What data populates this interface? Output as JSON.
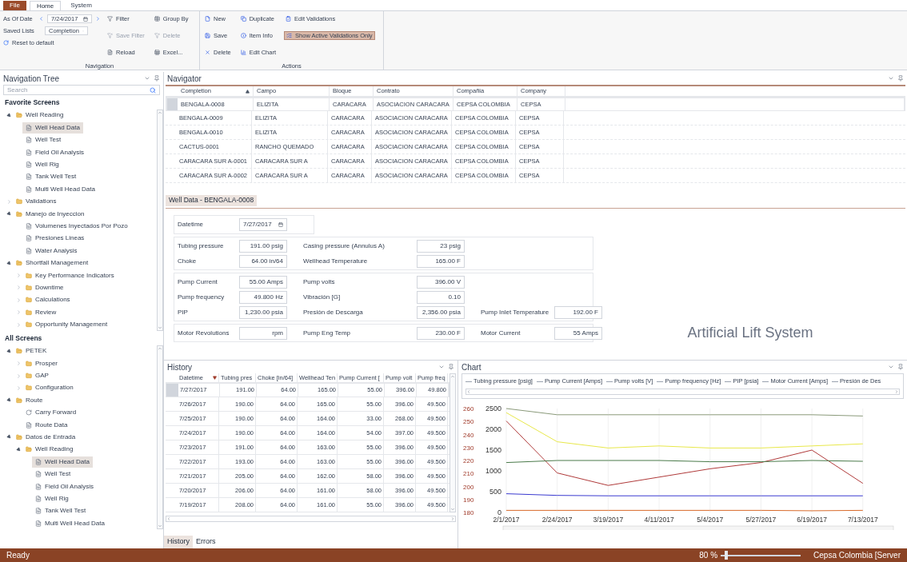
{
  "ribbon": {
    "tabs": [
      {
        "label": "File",
        "selected": false,
        "kind": "file"
      },
      {
        "label": "Home",
        "selected": true,
        "kind": "tab"
      },
      {
        "label": "System",
        "selected": false,
        "kind": "tab"
      }
    ],
    "navigation": {
      "title": "Navigation",
      "as_of_date_label": "As Of Date",
      "date": "7/24/2017",
      "saved_lists_label": "Saved Lists",
      "saved_list": "Completion",
      "reset": "Reset to default",
      "buttons": [
        {
          "label": "Filter",
          "disabled": false
        },
        {
          "label": "Save Filter",
          "disabled": true
        },
        {
          "label": "Reload",
          "disabled": false
        },
        {
          "label": "Group By",
          "disabled": false
        },
        {
          "label": "Delete",
          "disabled": true
        },
        {
          "label": "Excel...",
          "disabled": false
        }
      ]
    },
    "actions": {
      "title": "Actions",
      "buttons": [
        {
          "label": "New",
          "selected": false
        },
        {
          "label": "Save",
          "selected": false
        },
        {
          "label": "Delete",
          "selected": false
        },
        {
          "label": "Duplicate",
          "selected": false
        },
        {
          "label": "Item Info",
          "selected": false
        },
        {
          "label": "Edit Chart",
          "selected": false
        },
        {
          "label": "Edit Validations",
          "selected": false
        },
        {
          "label": "Show Active Validations Only",
          "selected": true
        }
      ]
    }
  },
  "navigation_tree": {
    "title": "Navigation Tree",
    "search_placeholder": "Search",
    "sections": [
      {
        "title": "Favorite Screens",
        "items": [
          {
            "label": "Well Reading",
            "kind": "folder",
            "expanded": true,
            "selected": false,
            "children": [
              {
                "label": "Well Head Data",
                "kind": "page",
                "selected": true
              },
              {
                "label": "Well Test",
                "kind": "page",
                "selected": false
              },
              {
                "label": "Field Oil Analysis",
                "kind": "page",
                "selected": false
              },
              {
                "label": "Well Rig",
                "kind": "page",
                "selected": false
              },
              {
                "label": "Tank Well Test",
                "kind": "page",
                "selected": false
              },
              {
                "label": "Multi Well Head Data",
                "kind": "page",
                "selected": false
              }
            ]
          },
          {
            "label": "Validations",
            "kind": "folder",
            "expanded": false,
            "selected": false
          },
          {
            "label": "Manejo de Inyeccion",
            "kind": "folder",
            "expanded": true,
            "selected": false,
            "children": [
              {
                "label": "Volumenes Inyectados Por Pozo",
                "kind": "page",
                "selected": false
              },
              {
                "label": "Presiones Lineas",
                "kind": "page",
                "selected": false
              },
              {
                "label": "Water Analysis",
                "kind": "page",
                "selected": false
              }
            ]
          },
          {
            "label": "Shortfall Management",
            "kind": "folder",
            "expanded": true,
            "selected": false,
            "children": [
              {
                "label": "Key Performance Indicators",
                "kind": "folder",
                "expanded": false,
                "selected": false
              },
              {
                "label": "Downtime",
                "kind": "folder",
                "expanded": false,
                "selected": false
              },
              {
                "label": "Calculations",
                "kind": "folder",
                "expanded": false,
                "selected": false
              },
              {
                "label": "Review",
                "kind": "folder",
                "expanded": false,
                "selected": false
              },
              {
                "label": "Opportunity Management",
                "kind": "folder",
                "expanded": false,
                "selected": false
              }
            ]
          }
        ]
      },
      {
        "title": "All Screens",
        "items": [
          {
            "label": "PETEK",
            "kind": "folder",
            "expanded": true,
            "selected": false,
            "children": [
              {
                "label": "Prosper",
                "kind": "folder",
                "expanded": false,
                "selected": false
              },
              {
                "label": "GAP",
                "kind": "folder",
                "expanded": false,
                "selected": false
              },
              {
                "label": "Configuration",
                "kind": "folder",
                "expanded": false,
                "selected": false
              }
            ]
          },
          {
            "label": "Route",
            "kind": "folder",
            "expanded": true,
            "selected": false,
            "children": [
              {
                "label": "Carry Forward",
                "kind": "forward",
                "selected": false
              },
              {
                "label": "Route Data",
                "kind": "page",
                "selected": false
              }
            ]
          },
          {
            "label": "Datos de Entrada",
            "kind": "folder",
            "expanded": true,
            "selected": false,
            "children": [
              {
                "label": "Well Reading",
                "kind": "folder",
                "expanded": true,
                "selected": false,
                "children": [
                  {
                    "label": "Well Head Data",
                    "kind": "page",
                    "selected": true
                  },
                  {
                    "label": "Well Test",
                    "kind": "page",
                    "selected": false
                  },
                  {
                    "label": "Field Oil Analysis",
                    "kind": "page",
                    "selected": false
                  },
                  {
                    "label": "Well Rig",
                    "kind": "page",
                    "selected": false
                  },
                  {
                    "label": "Tank Well Test",
                    "kind": "page",
                    "selected": false
                  },
                  {
                    "label": "Multi Well Head Data",
                    "kind": "page",
                    "selected": false
                  }
                ]
              }
            ]
          }
        ]
      }
    ]
  },
  "navigator": {
    "title": "Navigator",
    "columns": [
      {
        "label": "Completion",
        "sorted": true
      },
      {
        "label": "Campo",
        "sorted": false
      },
      {
        "label": "Bloque",
        "sorted": false
      },
      {
        "label": "Contrato",
        "sorted": false
      },
      {
        "label": "Compañia",
        "sorted": false
      },
      {
        "label": "Company",
        "sorted": false
      }
    ],
    "rows": [
      {
        "selected": true,
        "cells": [
          "BENGALA-0008",
          "ELIZITA",
          "CARACARA",
          "ASOCIACION CARACARA",
          "CEPSA COLOMBIA",
          "CEPSA"
        ]
      },
      {
        "selected": false,
        "cells": [
          "BENGALA-0009",
          "ELIZITA",
          "CARACARA",
          "ASOCIACION CARACARA",
          "CEPSA COLOMBIA",
          "CEPSA"
        ]
      },
      {
        "selected": false,
        "cells": [
          "BENGALA-0010",
          "ELIZITA",
          "CARACARA",
          "ASOCIACION CARACARA",
          "CEPSA COLOMBIA",
          "CEPSA"
        ]
      },
      {
        "selected": false,
        "cells": [
          "CACTUS-0001",
          "RANCHO QUEMADO",
          "CARACARA",
          "ASOCIACION CARACARA",
          "CEPSA COLOMBIA",
          "CEPSA"
        ]
      },
      {
        "selected": false,
        "cells": [
          "CARACARA SUR A-0001",
          "CARACARA SUR A",
          "CARACARA",
          "ASOCIACION CARACARA",
          "CEPSA COLOMBIA",
          "CEPSA"
        ]
      },
      {
        "selected": false,
        "cells": [
          "CARACARA SUR A-0002",
          "CARACARA SUR A",
          "CARACARA",
          "ASOCIACION CARACARA",
          "CEPSA COLOMBIA",
          "CEPSA"
        ]
      }
    ]
  },
  "well_data": {
    "title": "Well Data - BENGALA-0008",
    "datetime_label": "Datetime",
    "datetime": "7/27/2017",
    "side_label": "Artificial Lift System",
    "groups": [
      [
        [
          {
            "label": "Tubing pressure",
            "value": "191.00 psig"
          },
          {
            "label": "Casing pressure (Annulus A)",
            "value": "23 psig"
          }
        ],
        [
          {
            "label": "Choke",
            "value": "64.00 in/64"
          },
          {
            "label": "Wellhead Temperature",
            "value": "165.00 F"
          }
        ]
      ],
      [
        [
          {
            "label": "Pump Current",
            "value": "55.00 Amps"
          },
          {
            "label": "Pump volts",
            "value": "396.00 V"
          }
        ],
        [
          {
            "label": "Pump frequency",
            "value": "49.800 Hz"
          },
          {
            "label": "Vibración [G]",
            "value": "0.10"
          }
        ],
        [
          {
            "label": "PIP",
            "value": "1,230.00 psia"
          },
          {
            "label": "Presión de Descarga",
            "value": "2,356.00 psia"
          },
          {
            "label": "Pump Inlet Temperature",
            "value": "192.00 F"
          }
        ]
      ],
      [
        [
          {
            "label": "Motor Revolutions",
            "value": "rpm"
          },
          {
            "label": "Pump Eng Temp",
            "value": "230.00 F"
          },
          {
            "label": "Motor Current",
            "value": "55 Amps"
          }
        ]
      ]
    ]
  },
  "history": {
    "title": "History",
    "columns": [
      {
        "label": "Datetime",
        "sorted": true
      },
      {
        "label": "Tubing pres",
        "sorted": false
      },
      {
        "label": "Choke [in/64]",
        "sorted": false
      },
      {
        "label": "Wellhead Ten",
        "sorted": false
      },
      {
        "label": "Pump Current [",
        "sorted": false
      },
      {
        "label": "Pump volt",
        "sorted": false
      },
      {
        "label": "Pump freq",
        "sorted": false
      }
    ],
    "rows": [
      {
        "selected": true,
        "cells": [
          "7/27/2017",
          "191.00",
          "64.00",
          "165.00",
          "55.00",
          "396.00",
          "49.800"
        ]
      },
      {
        "selected": false,
        "cells": [
          "7/26/2017",
          "190.00",
          "64.00",
          "165.00",
          "55.00",
          "396.00",
          "49.500"
        ]
      },
      {
        "selected": false,
        "cells": [
          "7/25/2017",
          "190.00",
          "64.00",
          "164.00",
          "33.00",
          "268.00",
          "49.500"
        ]
      },
      {
        "selected": false,
        "cells": [
          "7/24/2017",
          "190.00",
          "64.00",
          "164.00",
          "54.00",
          "397.00",
          "49.500"
        ]
      },
      {
        "selected": false,
        "cells": [
          "7/23/2017",
          "191.00",
          "64.00",
          "163.00",
          "55.00",
          "396.00",
          "49.500"
        ]
      },
      {
        "selected": false,
        "cells": [
          "7/22/2017",
          "193.00",
          "64.00",
          "163.00",
          "55.00",
          "396.00",
          "49.500"
        ]
      },
      {
        "selected": false,
        "cells": [
          "7/21/2017",
          "205.00",
          "64.00",
          "162.00",
          "58.00",
          "396.00",
          "49.500"
        ]
      },
      {
        "selected": false,
        "cells": [
          "7/20/2017",
          "206.00",
          "64.00",
          "161.00",
          "58.00",
          "396.00",
          "49.500"
        ]
      },
      {
        "selected": false,
        "cells": [
          "7/19/2017",
          "208.00",
          "64.00",
          "161.00",
          "55.00",
          "396.00",
          "49.500"
        ]
      }
    ],
    "tabs": [
      {
        "label": "History",
        "selected": true
      },
      {
        "label": "Errors",
        "selected": false
      }
    ]
  },
  "chart_panel": {
    "title": "Chart",
    "legend_extra": [
      "Presión de Des"
    ],
    "secondary_yticks": [
      "260",
      "250",
      "240",
      "230",
      "220",
      "210",
      "200",
      "190",
      "180"
    ],
    "chart_data": {
      "type": "line",
      "x": [
        "2/1/2017",
        "2/24/2017",
        "3/19/2017",
        "4/11/2017",
        "5/4/2017",
        "5/27/2017",
        "6/19/2017",
        "7/13/2017"
      ],
      "yticks": [
        0,
        500,
        1000,
        1500,
        2000,
        2500
      ],
      "ylim": [
        0,
        2500
      ],
      "grid": true,
      "series": [
        {
          "name": "Tubing pressure [psig]",
          "color": "#b03a3a",
          "values": [
            2200,
            950,
            650,
            850,
            1050,
            1200,
            1500,
            700
          ]
        },
        {
          "name": "Pump Current [Amps]",
          "color": "#e8e84a",
          "values": [
            2400,
            1700,
            1550,
            1600,
            1550,
            1550,
            1600,
            1650
          ]
        },
        {
          "name": "Pump volts [V]",
          "color": "#8a9a7a",
          "values": [
            2500,
            2350,
            2350,
            2350,
            2350,
            2350,
            2350,
            2320
          ]
        },
        {
          "name": "Pump frequency [Hz]",
          "color": "#4a7a4a",
          "values": [
            1200,
            1250,
            1250,
            1250,
            1220,
            1220,
            1250,
            1230
          ]
        },
        {
          "name": "PIP [psia]",
          "color": "#3a3ad0",
          "values": [
            450,
            410,
            400,
            400,
            400,
            400,
            400,
            400
          ]
        },
        {
          "name": "Motor Current [Amps]",
          "color": "#d86a2a",
          "values": [
            50,
            50,
            50,
            50,
            50,
            50,
            40,
            50
          ]
        }
      ]
    }
  },
  "status_bar": {
    "text": "Ready",
    "zoom": "80 %",
    "level": 0.05,
    "server": "Cepsa Colombia [Server"
  }
}
